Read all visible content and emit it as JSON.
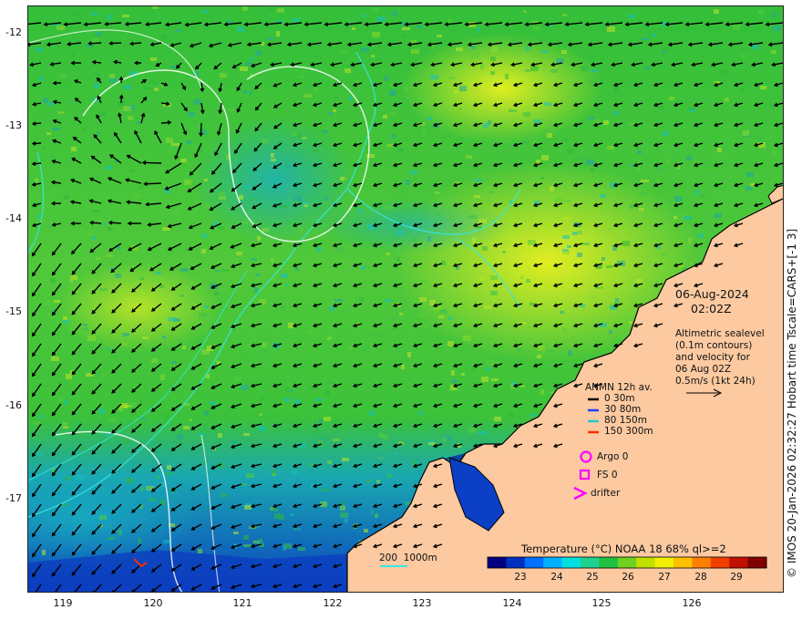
{
  "map": {
    "lat_ticks": [
      "-12",
      "-13",
      "-14",
      "-15",
      "-16",
      "-17"
    ],
    "lon_ticks": [
      "119",
      "120",
      "121",
      "122",
      "123",
      "124",
      "125",
      "126"
    ],
    "date": "06-Aug-2024",
    "time": "02:02Z"
  },
  "altimetry_note": {
    "line1": "Altimetric sealevel",
    "line2": "(0.1m contours)",
    "line3": "and velocity for",
    "line4": "06 Aug 02Z",
    "line5": "0.5m/s (1kt 24h)"
  },
  "anmn_legend": {
    "title": "ANMN 12h av.",
    "items": [
      {
        "label": "0 30m",
        "color": "#000000"
      },
      {
        "label": "30 80m",
        "color": "#1f3fff"
      },
      {
        "label": "80 150m",
        "color": "#23c8c8"
      },
      {
        "label": "150 300m",
        "color": "#ff2a00"
      }
    ]
  },
  "markers_legend": {
    "argo": "Argo 0",
    "fs": "FS 0",
    "drifter": "drifter"
  },
  "bathy_label": "200  1000m",
  "colorbar": {
    "title": "Temperature (°C) NOAA 18 68% ql>=2",
    "ticks": [
      "23",
      "24",
      "25",
      "26",
      "27",
      "28",
      "29"
    ],
    "colors": [
      "#000080",
      "#0030c0",
      "#0070ff",
      "#00b0ff",
      "#00e0e0",
      "#20d090",
      "#20c040",
      "#70d020",
      "#c0e000",
      "#f0f000",
      "#ffc000",
      "#ff8000",
      "#f04000",
      "#c01000",
      "#800000"
    ]
  },
  "side_label": "© IMOS 20-Jan-2026 02:32:27 Hobart time Tscale=CARS+[-1 3]",
  "colors": {
    "land": "#fcc9a0",
    "sea_green": "#3fc83a",
    "sea_yellow": "#d8f020",
    "sea_cyan": "#18b8b8",
    "sea_blue": "#0840d0",
    "marker_magenta": "#ff00ff"
  }
}
